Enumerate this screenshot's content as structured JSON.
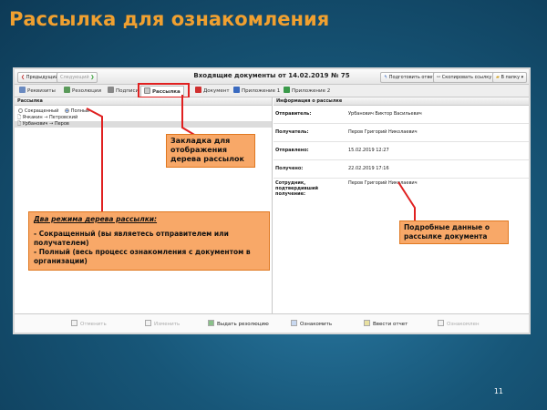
{
  "slide": {
    "title": "Рассылка для ознакомления",
    "page_number": "11"
  },
  "window": {
    "title": "Входящие документы от 14.02.2019 № 75"
  },
  "toolbar": {
    "prev": "Предыдущий",
    "next": "Следующий",
    "prepare_reply": "Подготовить ответ",
    "copy_link": "Скопировать ссылку",
    "to_folder": "В папку"
  },
  "tabs": [
    "Реквизиты",
    "Резолюции",
    "Подписи",
    "Рассылка",
    "Документ",
    "Приложение 1",
    "Приложение 2"
  ],
  "left_panel": {
    "header": "Рассылка",
    "radio_short": "Сокращенный",
    "radio_full": "Полный",
    "rows": [
      "Ячкакин → Петровский",
      "Урбанович → Перов"
    ]
  },
  "right_panel": {
    "header": "Информация о рассылке",
    "rows": [
      {
        "label": "Отправитель:",
        "value": "Урбанович Виктор Васильевич"
      },
      {
        "label": "Получатель:",
        "value": "Перов Григорий Николаевич"
      },
      {
        "label": "Отправлено:",
        "value": "15.02.2019 12:27"
      },
      {
        "label": "Получено:",
        "value": "22.02.2019 17:16"
      },
      {
        "label": "Сотрудник, подтвердивший получение:",
        "value": "Перов Григорий Николаевич"
      }
    ]
  },
  "bottom_bar": {
    "cancel": "Отменить",
    "edit": "Изменить",
    "issue_resolution": "Выдать резолюцию",
    "acknowledge": "Ознакомить",
    "enter_report": "Ввести отчет",
    "acquaint": "Ознакомлен"
  },
  "callouts": {
    "tab_tree": "Закладка для отображения дерева рассылок",
    "modes_title": "Два режима дерева рассылки:",
    "mode_short": "- Сокращенный (вы являетесь отправителем или получателем)",
    "mode_full": "- Полный (весь процесс ознакомления с документом в организации)",
    "details": "Подробные данные о рассылке документа"
  },
  "colors": {
    "title": "#f0a030",
    "callout_fill": "#f8a868",
    "callout_border": "#e07820",
    "highlight": "#e02020"
  }
}
